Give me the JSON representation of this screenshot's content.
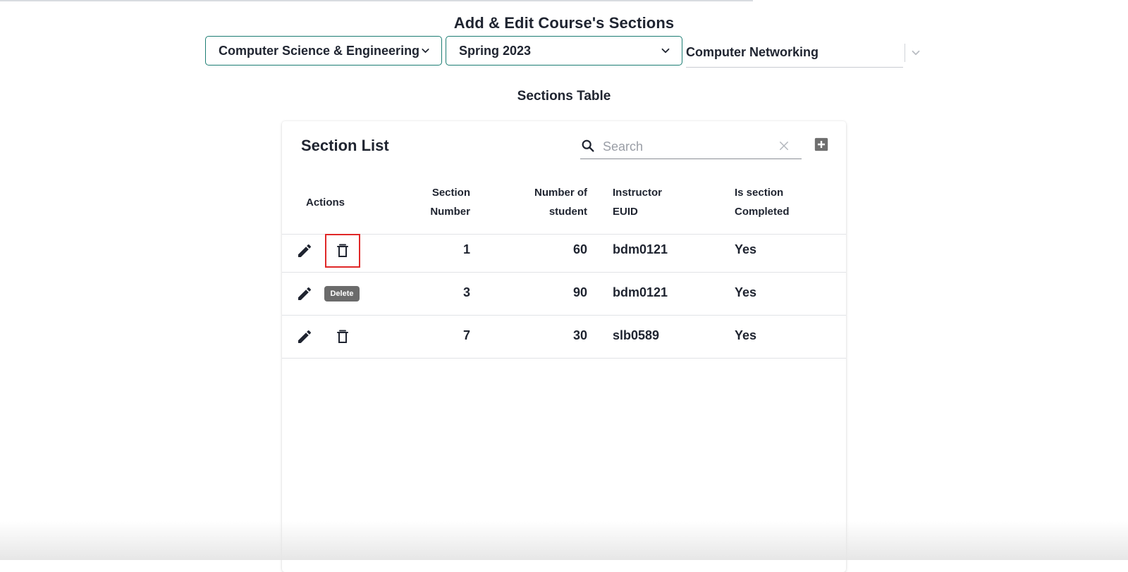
{
  "page": {
    "title": "Add & Edit Course's Sections",
    "department_select": "Computer Science & Engineering",
    "term_select": "Spring 2023",
    "course_select": "Computer Networking",
    "section_heading": "Sections Table"
  },
  "table": {
    "title": "Section List",
    "search_placeholder": "Search",
    "columns": {
      "actions": "Actions",
      "section_number_l1": "Section",
      "section_number_l2": "Number",
      "num_students_l1": "Number of",
      "num_students_l2": "student",
      "instructor_l1": "Instructor",
      "instructor_l2": "EUID",
      "completed_l1": "Is section",
      "completed_l2": "Completed"
    },
    "rows": [
      {
        "section_number": "1",
        "num_students": "60",
        "instructor_euid": "bdm0121",
        "completed": "Yes"
      },
      {
        "section_number": "3",
        "num_students": "90",
        "instructor_euid": "bdm0121",
        "completed": "Yes"
      },
      {
        "section_number": "7",
        "num_students": "30",
        "instructor_euid": "slb0589",
        "completed": "Yes"
      }
    ],
    "tooltip": "Delete"
  },
  "colors": {
    "select_border": "#1c7d73",
    "highlight": "#e02828",
    "tooltip_bg": "#6b6b6b"
  },
  "icons": [
    "chevron-down-icon",
    "search-icon",
    "close-icon",
    "add-box-icon",
    "edit-icon",
    "delete-icon"
  ]
}
